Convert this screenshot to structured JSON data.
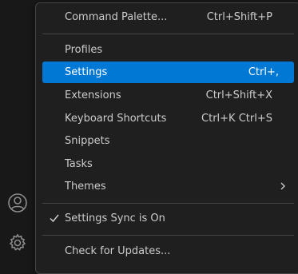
{
  "menu": {
    "items": [
      {
        "label": "Command Palette...",
        "shortcut": "Ctrl+Shift+P"
      },
      {
        "label": "Profiles",
        "shortcut": ""
      },
      {
        "label": "Settings",
        "shortcut": "Ctrl+,"
      },
      {
        "label": "Extensions",
        "shortcut": "Ctrl+Shift+X"
      },
      {
        "label": "Keyboard Shortcuts",
        "shortcut": "Ctrl+K Ctrl+S"
      },
      {
        "label": "Snippets",
        "shortcut": ""
      },
      {
        "label": "Tasks",
        "shortcut": ""
      },
      {
        "label": "Themes",
        "shortcut": ""
      },
      {
        "label": "Settings Sync is On",
        "shortcut": ""
      },
      {
        "label": "Check for Updates...",
        "shortcut": ""
      }
    ]
  },
  "icons": {
    "account": "account-icon",
    "manage": "gear-icon",
    "check": "check-icon",
    "submenu": "chevron-right-icon"
  },
  "colors": {
    "highlight": "#0078d4",
    "menu_bg": "#1f1f1f",
    "text": "#cccccc"
  }
}
